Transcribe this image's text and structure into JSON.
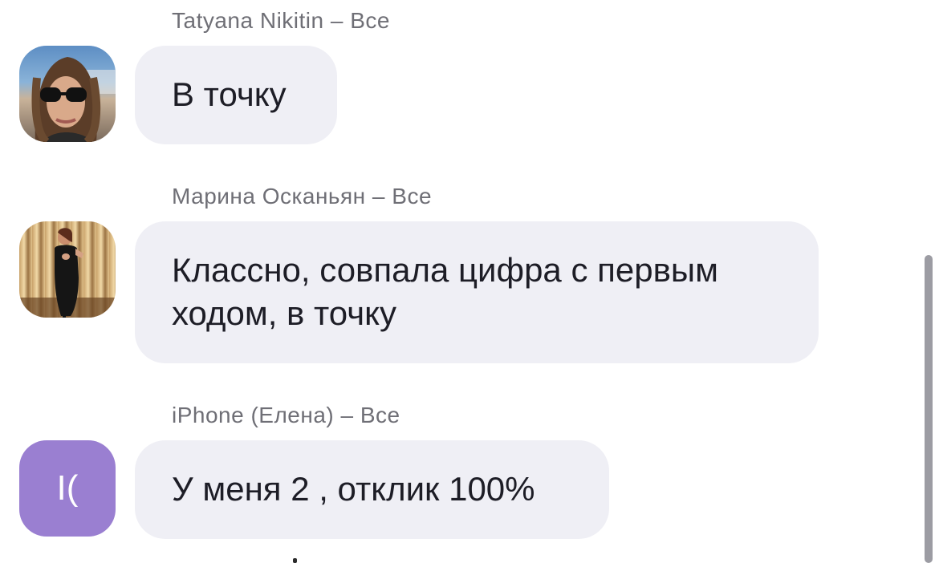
{
  "messages": [
    {
      "sender": "Tatyana Nikitin – Все",
      "text": "В точку",
      "avatar": {
        "kind": "photo",
        "description_icon": "person-photo-icon"
      }
    },
    {
      "sender": "Марина Осканьян – Все",
      "text": "Классно, совпала цифра с первым ходом, в точку",
      "avatar": {
        "kind": "photo",
        "description_icon": "person-photo-icon"
      }
    },
    {
      "sender": "iPhone (Елена) – Все",
      "text": "У меня 2 , отклик 100%",
      "avatar": {
        "kind": "initials",
        "initials": "I(",
        "color": "#9a7fd1"
      }
    }
  ],
  "colors": {
    "bubble": "#efeff5",
    "sender_text": "#6f6f76",
    "message_text": "#1d1d26",
    "scrollbar": "#9c9ca3"
  }
}
